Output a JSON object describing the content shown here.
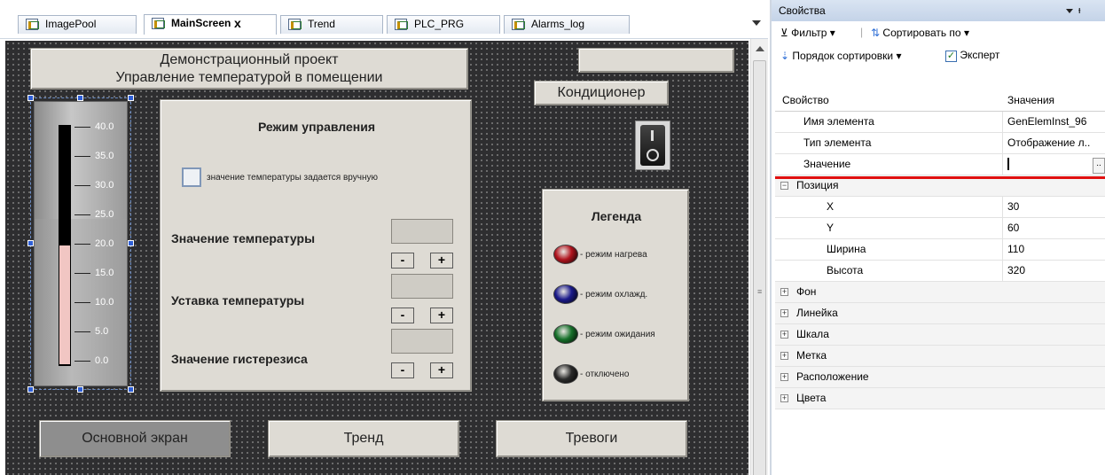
{
  "tabs": [
    {
      "label": "ImagePool",
      "active": false
    },
    {
      "label": "MainScreen",
      "active": true,
      "close": "x"
    },
    {
      "label": "Trend",
      "active": false
    },
    {
      "label": "PLC_PRG",
      "active": false
    },
    {
      "label": "Alarms_log",
      "active": false
    }
  ],
  "screen": {
    "title_line1": "Демонстрационный проект",
    "title_line2": "Управление температурой в помещении",
    "ac_button": "Кондиционер",
    "thermometer": {
      "ticks": [
        "40.0",
        "35.0",
        "30.0",
        "25.0",
        "20.0",
        "15.0",
        "10.0",
        "5.0",
        "0.0"
      ]
    },
    "mode_panel": {
      "title": "Режим управления",
      "checkbox_label": "значение температуры задается вручную",
      "rows": [
        {
          "label": "Значение температуры",
          "minus": "-",
          "plus": "+"
        },
        {
          "label": "Уставка температуры",
          "minus": "-",
          "plus": "+"
        },
        {
          "label": "Значение гистерезиса",
          "minus": "-",
          "plus": "+"
        }
      ]
    },
    "legend": {
      "title": "Легенда",
      "items": [
        {
          "label": "- режим нагрева",
          "color": "#b0141e"
        },
        {
          "label": "- режим охлажд.",
          "color": "#1a1a8a"
        },
        {
          "label": "- режим ожидания",
          "color": "#16702a"
        },
        {
          "label": "- отключено",
          "color": "#2a2a2a"
        }
      ]
    },
    "nav": {
      "main": "Основной экран",
      "trend": "Тренд",
      "alarms": "Тревоги"
    }
  },
  "properties": {
    "title": "Свойства",
    "toolbar": {
      "filter": "Фильтр",
      "sort_by": "Сортировать по",
      "sort_order": "Порядок сортировки",
      "expert": "Эксперт"
    },
    "header": {
      "property": "Свойство",
      "values": "Значения"
    },
    "rows": [
      {
        "key": "Имя элемента",
        "value": "GenElemInst_96",
        "type": "row"
      },
      {
        "key": "Тип элемента",
        "value": "Отображение л..",
        "type": "row"
      },
      {
        "key": "Значение",
        "value": "",
        "type": "row"
      },
      {
        "key": "Позиция",
        "value": "",
        "type": "group-open"
      },
      {
        "key": "X",
        "value": "30",
        "type": "sub"
      },
      {
        "key": "Y",
        "value": "60",
        "type": "sub"
      },
      {
        "key": "Ширина",
        "value": "110",
        "type": "sub"
      },
      {
        "key": "Высота",
        "value": "320",
        "type": "sub"
      },
      {
        "key": "Фон",
        "value": "",
        "type": "group"
      },
      {
        "key": "Линейка",
        "value": "",
        "type": "group"
      },
      {
        "key": "Шкала",
        "value": "",
        "type": "group"
      },
      {
        "key": "Метка",
        "value": "",
        "type": "group"
      },
      {
        "key": "Расположение",
        "value": "",
        "type": "group"
      },
      {
        "key": "Цвета",
        "value": "",
        "type": "group"
      }
    ]
  }
}
